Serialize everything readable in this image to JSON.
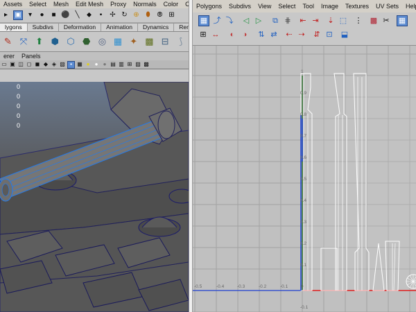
{
  "main_window": {
    "menu": [
      "Assets",
      "Select",
      "Mesh",
      "Edit Mesh",
      "Proxy",
      "Normals",
      "Color",
      "Create UV"
    ],
    "status_icons": [
      "select-tool-icon",
      "lasso-icon",
      "paint-select-icon",
      "point-icon",
      "move-icon",
      "rotate-icon",
      "scale-icon",
      "magnet-icon",
      "snap-icon"
    ],
    "shelf_tabs": [
      "lygons",
      "Subdivs",
      "Deformation",
      "Animation",
      "Dynamics",
      "Rendering"
    ],
    "active_shelf_tab": "lygons",
    "shelf_icons": [
      "paint-icon",
      "axis-icon",
      "extrude-icon",
      "bevel-icon",
      "smooth-icon",
      "cube-icon",
      "sphere-icon",
      "uv-icon",
      "texture-icon",
      "crate-icon",
      "grid-icon",
      "light-icon"
    ],
    "panel_menu": [
      "erer",
      "Panels"
    ],
    "viewport_column_values": [
      "0",
      "0",
      "0",
      "0",
      "0"
    ]
  },
  "uv_editor": {
    "menu": [
      "Polygons",
      "Subdivs",
      "View",
      "Select",
      "Tool",
      "Image",
      "Textures",
      "UV Sets",
      "Help"
    ],
    "toolbar_row1": [
      "grid-view-icon",
      "move-uv-icon",
      "rotate-uv-icon",
      "flip-icon",
      "flip-v-icon",
      "cut-uv-icon",
      "sew-uv-icon",
      "align-icon",
      "stack-icon",
      "layout-icon",
      "pin-icon",
      "unpin-icon",
      "checker-icon",
      "snapshot-icon",
      "grid-display-icon"
    ],
    "toolbar_row2": [
      "select-uv-icon",
      "shell-icon",
      "unfold-icon",
      "relax-icon",
      "straighten-icon",
      "distribute-icon",
      "normalize-icon",
      "shade-uv-icon"
    ],
    "grid_labels_x": [
      "-0.5",
      "-0.4",
      "-0.3",
      "-0.2",
      "-0.1",
      "0"
    ],
    "grid_labels_y": [
      "1",
      "0.9",
      "0.8",
      "0.7",
      "0.6",
      "0.5",
      "0.4",
      "0.3",
      "0.2",
      "0.1",
      "-0.1"
    ],
    "colors": {
      "u_axis": "#e02020",
      "v_axis": "#2a6a2a",
      "uv_border": "#1a40d0",
      "uv_shell": "#ffffff",
      "grid": "#a2a2a2"
    }
  }
}
